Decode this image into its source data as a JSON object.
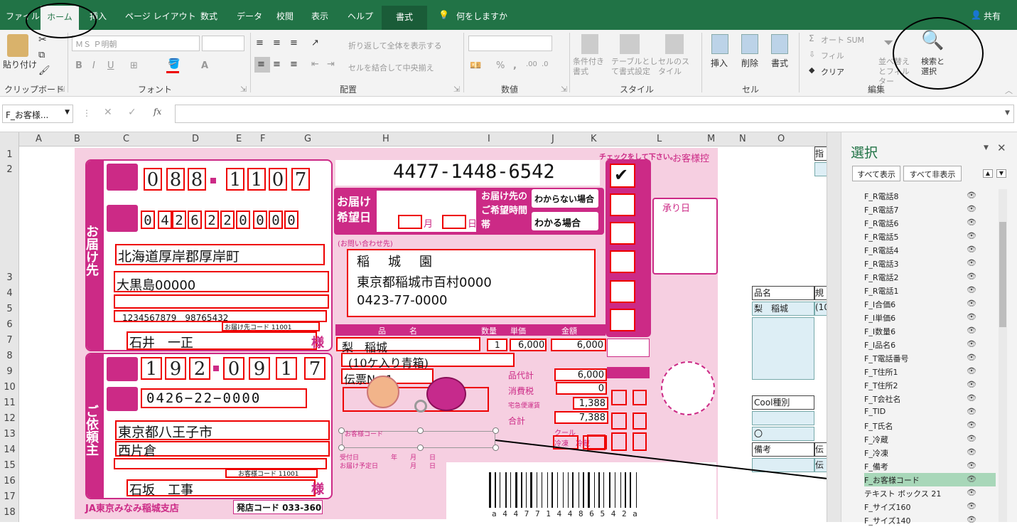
{
  "ribbon_tabs": [
    "ファイル",
    "ホーム",
    "挿入",
    "ページ レイアウト",
    "数式",
    "データ",
    "校閲",
    "表示",
    "ヘルプ",
    "書式"
  ],
  "tell_me": "何をしますか",
  "share": "共有",
  "clipboard": {
    "paste": "貼り付け",
    "label": "クリップボード"
  },
  "font": {
    "name": "ＭＳ Ｐ明朝",
    "label": "フォント"
  },
  "alignment": {
    "wrap": "折り返して全体を表示する",
    "merge": "セルを結合して中央揃え",
    "label": "配置"
  },
  "number": {
    "label": "数値"
  },
  "styles": {
    "cond": "条件付き書式",
    "table": "テーブルとして書式設定",
    "cell": "セルのスタイル",
    "label": "スタイル"
  },
  "cells": {
    "insert": "挿入",
    "delete": "削除",
    "format": "書式",
    "label": "セル"
  },
  "editing": {
    "autosum": "オート SUM",
    "fill": "フィル",
    "clear": "クリア",
    "sort": "並べ替えとフィルター",
    "find": "検索と選択",
    "label": "編集"
  },
  "namebox": "F_お客様...",
  "columns": [
    "A",
    "B",
    "C",
    "D",
    "E",
    "F",
    "G",
    "H",
    "I",
    "J",
    "K",
    "L",
    "M",
    "N",
    "O"
  ],
  "rows": [
    "1",
    "2",
    "3",
    "4",
    "5",
    "6",
    "7",
    "8",
    "9",
    "10",
    "11",
    "12",
    "13",
    "14",
    "15",
    "16",
    "17",
    "18"
  ],
  "form": {
    "tracking": "4477-1448-6542",
    "to_postal": [
      "0",
      "8",
      "8",
      "1",
      "1",
      "0",
      "7"
    ],
    "to_tel": [
      "0",
      "4",
      "2",
      "6",
      "2",
      "2",
      "0",
      "0",
      "0",
      "0"
    ],
    "to_addr1": "北海道厚岸郡厚岸町",
    "to_addr2": "大黒島00000",
    "to_codes": "1234567879　98765432",
    "to_code_label": "お届け先コード 11001",
    "to_name": "石井　一正",
    "from_postal": [
      "1",
      "9",
      "2",
      "0",
      "9",
      "1",
      "7"
    ],
    "from_tel": "0426−22−0000",
    "from_addr1": "東京都八王子市",
    "from_addr2": "西片倉",
    "from_code_label": "お客様コード 11001",
    "from_name": "石坂　工事",
    "inq_name": "稲　城　園",
    "inq_addr": "東京都稲城市百村0000",
    "inq_tel": "0423-77-0000",
    "item1": "梨　稲城",
    "item2": "(10ケ入り青箱)",
    "item3": "伝票No 1",
    "qty": "1",
    "price": "6,000",
    "amount": "6,000",
    "subtotal": "6,000",
    "tax": "0",
    "cool_fee": "1,388",
    "total": "7,388",
    "branch": "JA東京みなみ稲城支店",
    "shop_code": "発店コード 033-360",
    "barcode": "a 4 4 7 7 1 4 4 8 6 5 4 2 a",
    "to_label": "お届け先",
    "from_label": "ご依頼主",
    "sama": "様",
    "inq_label": "(お問い合わせ先)",
    "product_label": "品　　　名",
    "qty_label": "数量",
    "price_label": "単価",
    "amount_label": "金額",
    "subtotal_label": "品代計",
    "tax_label": "消費税",
    "cool_label": "宅急便運賃",
    "total_label": "合計",
    "delivery_label": "お届け希望日",
    "month": "月",
    "day": "日",
    "unknown": "わからない場合",
    "known": "わかる場合",
    "time_label": "お届け先のご希望時間帯",
    "check_label": "チェックをして下さい。",
    "customer_copy": "お客様控",
    "received": "承り日",
    "cust_code": "お客様コード",
    "cool": "クール",
    "cool_opts": "冷凍　冷蔵"
  },
  "sheet_cells": {
    "o4": "品名",
    "o5": "梨　稲城",
    "o11": "Cool種別",
    "o13": "〇",
    "o14": "備考",
    "p14": "伝",
    "p15": "伝",
    "p1": "指",
    "p4": "規",
    "p5": "(10"
  },
  "selection_pane": {
    "title": "選択",
    "show_all": "すべて表示",
    "hide_all": "すべて非表示",
    "items": [
      "F_R電話8",
      "F_R電話7",
      "F_R電話6",
      "F_R電話5",
      "F_R電話4",
      "F_R電話3",
      "F_R電話2",
      "F_R電話1",
      "F_I合価6",
      "F_I単価6",
      "F_I数量6",
      "F_I品名6",
      "F_T電話番号",
      "F_T住所1",
      "F_T住所2",
      "F_T会社名",
      "F_TID",
      "F_T氏名",
      "F_冷蔵",
      "F_冷凍",
      "F_備考",
      "F_お客様コード",
      "テキスト ボックス 21",
      "F_サイズ160",
      "F_サイズ140"
    ],
    "selected_index": 21
  }
}
